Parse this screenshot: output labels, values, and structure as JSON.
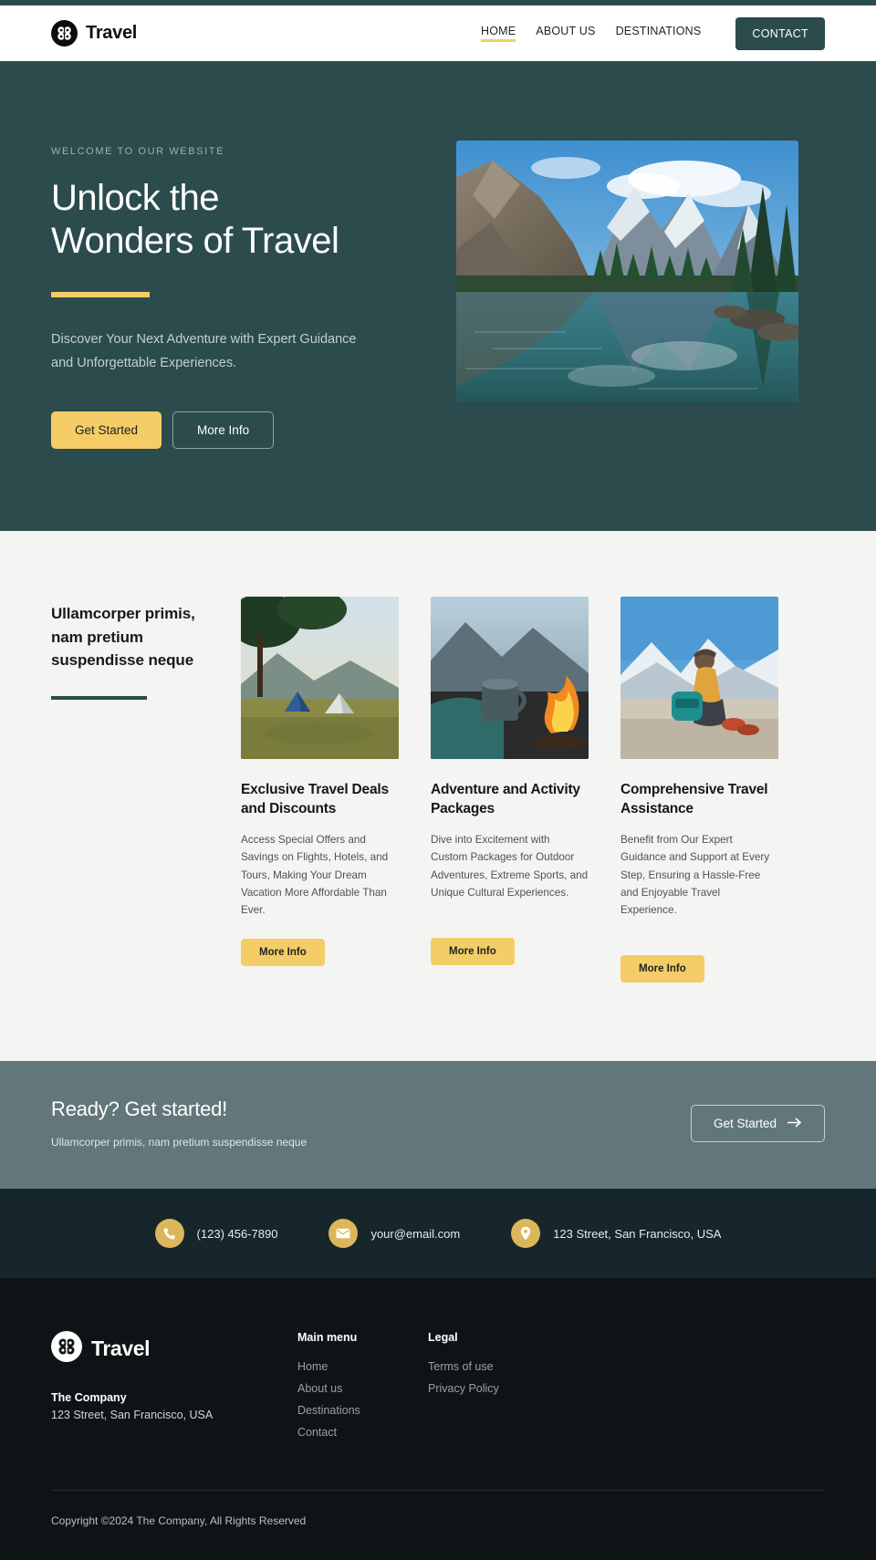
{
  "brand": {
    "name": "Travel",
    "logo_icon": "clover-circle-logo"
  },
  "header": {
    "nav": [
      {
        "label": "HOME",
        "active": true
      },
      {
        "label": "ABOUT US",
        "active": false
      },
      {
        "label": "DESTINATIONS",
        "active": false
      }
    ],
    "contact_button": "CONTACT",
    "accent_color": "#f4cd66",
    "brand_color": "#2b4b4c"
  },
  "hero": {
    "eyebrow": "WELCOME TO OUR WEBSITE",
    "title_line1": "Unlock the",
    "title_line2": "Wonders of Travel",
    "subtitle": "Discover Your Next Adventure with Expert Guidance and Unforgettable Experiences.",
    "primary_button": "Get Started",
    "secondary_button": "More Info",
    "image_alt": "mountain-lake-reflection-photo"
  },
  "features": {
    "heading": "Ullamcorper primis, nam pretium suspendisse neque",
    "cards": [
      {
        "title": "Exclusive Travel Deals and Discounts",
        "body": "Access Special Offers and Savings on Flights, Hotels, and Tours, Making Your Dream Vacation More Affordable Than Ever.",
        "button": "More Info",
        "image_alt": "camping-tents-hillside-photo"
      },
      {
        "title": "Adventure and Activity Packages",
        "body": "Dive into Excitement with Custom Packages for Outdoor Adventures, Extreme Sports, and Unique Cultural Experiences.",
        "button": "More Info",
        "image_alt": "campfire-mug-photo"
      },
      {
        "title": "Comprehensive Travel Assistance",
        "body": "Benefit from Our Expert Guidance and Support at Every Step, Ensuring a Hassle-Free and Enjoyable Travel Experience.",
        "button": "More Info",
        "image_alt": "hiker-sitting-mountain-view-photo"
      }
    ]
  },
  "cta": {
    "title": "Ready? Get started!",
    "subtitle": "Ullamcorper primis, nam pretium suspendisse neque",
    "button": "Get Started",
    "button_icon": "arrow-right-icon"
  },
  "contact_bar": {
    "phone": "(123) 456-7890",
    "email": "your@email.com",
    "address": "123 Street, San Francisco, USA",
    "phone_icon": "phone-icon",
    "email_icon": "envelope-icon",
    "address_icon": "map-pin-icon"
  },
  "footer": {
    "company_label": "The Company",
    "company_address": "123 Street, San Francisco, USA",
    "main_menu_title": "Main menu",
    "main_menu": [
      {
        "label": "Home"
      },
      {
        "label": "About us"
      },
      {
        "label": "Destinations"
      },
      {
        "label": "Contact"
      }
    ],
    "legal_title": "Legal",
    "legal": [
      {
        "label": "Terms of use"
      },
      {
        "label": "Privacy Policy"
      }
    ],
    "copyright": "Copyright ©2024 The Company, All Rights Reserved"
  }
}
